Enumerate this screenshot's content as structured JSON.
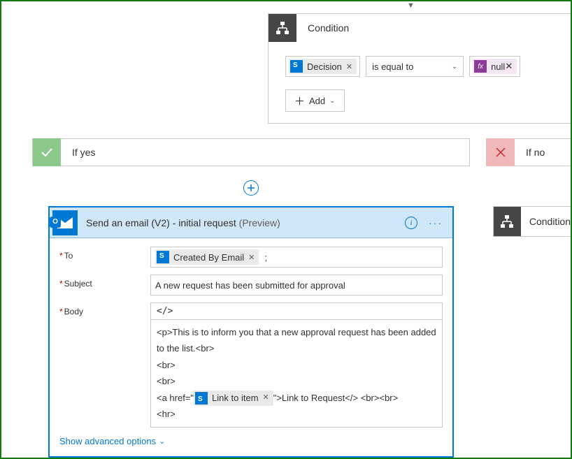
{
  "condition": {
    "title": "Condition",
    "left_token": "Decision",
    "operator": "is equal to",
    "right_fx": "null",
    "add_label": "Add"
  },
  "branches": {
    "yes_label": "If yes",
    "no_label": "If no"
  },
  "email_action": {
    "title_main": "Send an email (V2) - initial request",
    "title_preview": "(Preview)",
    "to_label": "To",
    "to_token": "Created By Email",
    "subject_label": "Subject",
    "subject_value": "A new request has been submitted for approval",
    "body_label": "Body",
    "code_toggle": "</>",
    "body_line1": "<p>This is to inform you that a new approval request has been added to the list.<br>",
    "body_line2": "<br>",
    "body_line3": "<br>",
    "body_href_prefix": "<a href=\"",
    "body_link_token": "Link to item",
    "body_href_suffix": "\">Link to Request</> <br><br>",
    "body_line5": "<hr>",
    "advanced_link": "Show advanced options"
  },
  "condition2": {
    "title": "Condition"
  }
}
